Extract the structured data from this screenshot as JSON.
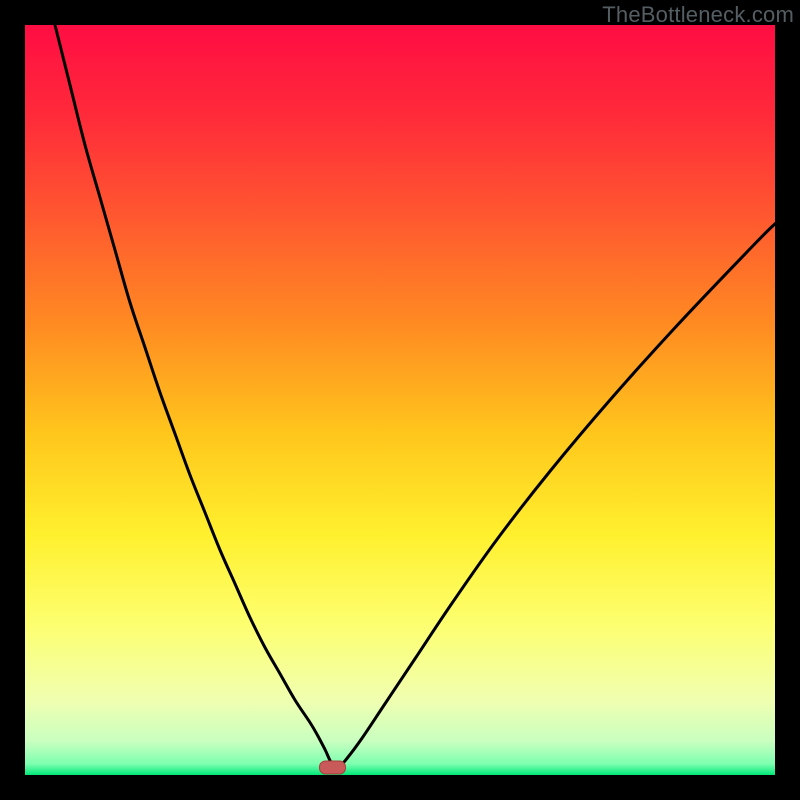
{
  "watermark": "TheBottleneck.com",
  "colors": {
    "border": "#000000",
    "curve": "#000000",
    "marker_fill": "#c95a5a",
    "marker_stroke": "#a83d3d",
    "gradient_stops": [
      {
        "offset": 0.0,
        "color": "#ff0d43"
      },
      {
        "offset": 0.12,
        "color": "#ff2a3a"
      },
      {
        "offset": 0.25,
        "color": "#ff5630"
      },
      {
        "offset": 0.4,
        "color": "#ff8b22"
      },
      {
        "offset": 0.55,
        "color": "#ffc81c"
      },
      {
        "offset": 0.68,
        "color": "#fff02e"
      },
      {
        "offset": 0.8,
        "color": "#fdff70"
      },
      {
        "offset": 0.9,
        "color": "#f0ffb0"
      },
      {
        "offset": 0.955,
        "color": "#c9ffc0"
      },
      {
        "offset": 0.985,
        "color": "#7effb0"
      },
      {
        "offset": 1.0,
        "color": "#00e878"
      }
    ]
  },
  "chart_data": {
    "type": "line",
    "title": "",
    "xlabel": "",
    "ylabel": "",
    "xlim": [
      0,
      100
    ],
    "ylim": [
      0,
      100
    ],
    "grid": false,
    "marker": {
      "x": 41,
      "y": 1,
      "shape": "rounded-rect"
    },
    "series": [
      {
        "name": "curve",
        "x": [
          4,
          6,
          8,
          10,
          12,
          14,
          16,
          18,
          20,
          22,
          24,
          26,
          28,
          30,
          32,
          34,
          36,
          38,
          39,
          40,
          41,
          42,
          43,
          45,
          48,
          52,
          57,
          63,
          70,
          78,
          87,
          97,
          100
        ],
        "y": [
          100,
          92,
          84,
          77,
          70,
          63,
          57,
          51,
          45.5,
          40,
          35,
          30,
          25.5,
          21,
          17,
          13.5,
          10,
          7,
          5.3,
          3.4,
          1.4,
          1.3,
          2.3,
          5,
          9.5,
          15.5,
          23,
          31.5,
          40.5,
          50,
          60,
          70.5,
          73.5
        ]
      }
    ]
  }
}
